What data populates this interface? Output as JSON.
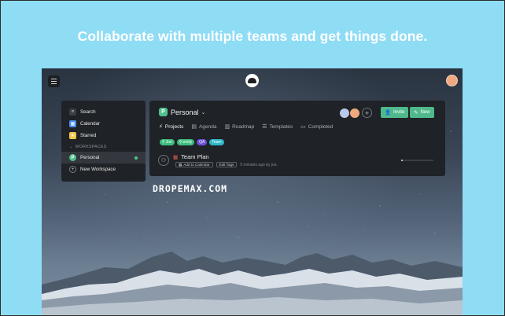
{
  "headline": "Collaborate with multiple teams and get things done.",
  "sidebar": {
    "items": [
      {
        "label": "Search",
        "icon": "search-icon",
        "color": "#3a3f46"
      },
      {
        "label": "Calendar",
        "icon": "calendar-icon",
        "color": "#4a8ee8"
      },
      {
        "label": "Starred",
        "icon": "star-icon",
        "color": "#f1c94a"
      }
    ],
    "section_label": "WORKSPACES",
    "workspaces": [
      {
        "label": "Personal",
        "badge": "P",
        "active": true
      }
    ],
    "new_workspace_label": "New Workspace"
  },
  "workspace": {
    "title": "Personal",
    "badge": "P"
  },
  "actions": {
    "invite_label": "Invite",
    "new_label": "New"
  },
  "tabs": [
    {
      "label": "Projects",
      "icon": "projects-icon",
      "active": true
    },
    {
      "label": "Agenda",
      "icon": "agenda-icon"
    },
    {
      "label": "Roadmap",
      "icon": "roadmap-icon"
    },
    {
      "label": "Templates",
      "icon": "templates-icon"
    },
    {
      "label": "Completed",
      "icon": "completed-icon"
    }
  ],
  "tags": [
    {
      "label": "Joe",
      "color": "#3dbd7d"
    },
    {
      "label": "emily",
      "color": "#3dbd7d"
    },
    {
      "label": "QA",
      "color": "#6a4fd6"
    },
    {
      "label": "Team",
      "color": "#2fb5c8"
    }
  ],
  "task": {
    "title": "Team Plan",
    "add_calendar_label": "Add to Calendar",
    "edit_tags_label": "Edit Tags",
    "meta": "5 minutes ago by joe."
  },
  "watermark": "DROPEMAX.COM",
  "colors": {
    "background": "#8fdcf5",
    "accent": "#4fb98c",
    "panel": "#1f2226"
  }
}
